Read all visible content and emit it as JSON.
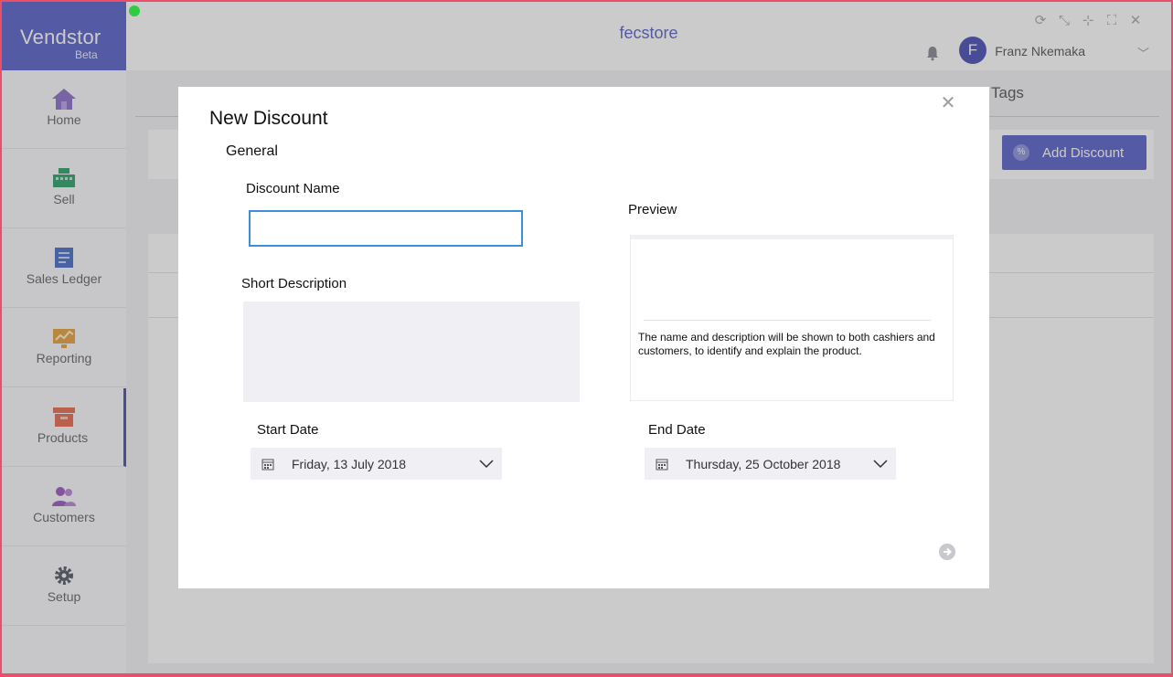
{
  "brand": {
    "name": "Vendstor",
    "sub": "Beta"
  },
  "header": {
    "store": "fecstore",
    "user_initial": "F",
    "user_name": "Franz Nkemaka"
  },
  "sidebar": {
    "items": [
      {
        "label": "Home",
        "icon": "home-icon",
        "color": "#8d6fc9"
      },
      {
        "label": "Sell",
        "icon": "cash-register-icon",
        "color": "#2ea36a"
      },
      {
        "label": "Sales Ledger",
        "icon": "ledger-icon",
        "color": "#4a6fc8"
      },
      {
        "label": "Reporting",
        "icon": "chart-icon",
        "color": "#e6a23c"
      },
      {
        "label": "Products",
        "icon": "box-icon",
        "color": "#e86b4f"
      },
      {
        "label": "Customers",
        "icon": "people-icon",
        "color": "#9b59c4"
      },
      {
        "label": "Setup",
        "icon": "gear-icon",
        "color": "#555a66"
      }
    ]
  },
  "background": {
    "tags_label": "Tags",
    "add_discount_label": "Add Discount"
  },
  "modal": {
    "title": "New Discount",
    "section": "General",
    "name_label": "Discount Name",
    "name_value": "",
    "desc_label": "Short Description",
    "desc_value": "",
    "preview_label": "Preview",
    "preview_text": "The name and description will be shown to both cashiers and customers, to identify and explain the product.",
    "start_label": "Start Date",
    "start_value": "Friday, 13 July 2018",
    "end_label": "End Date",
    "end_value": "Thursday, 25 October 2018"
  }
}
